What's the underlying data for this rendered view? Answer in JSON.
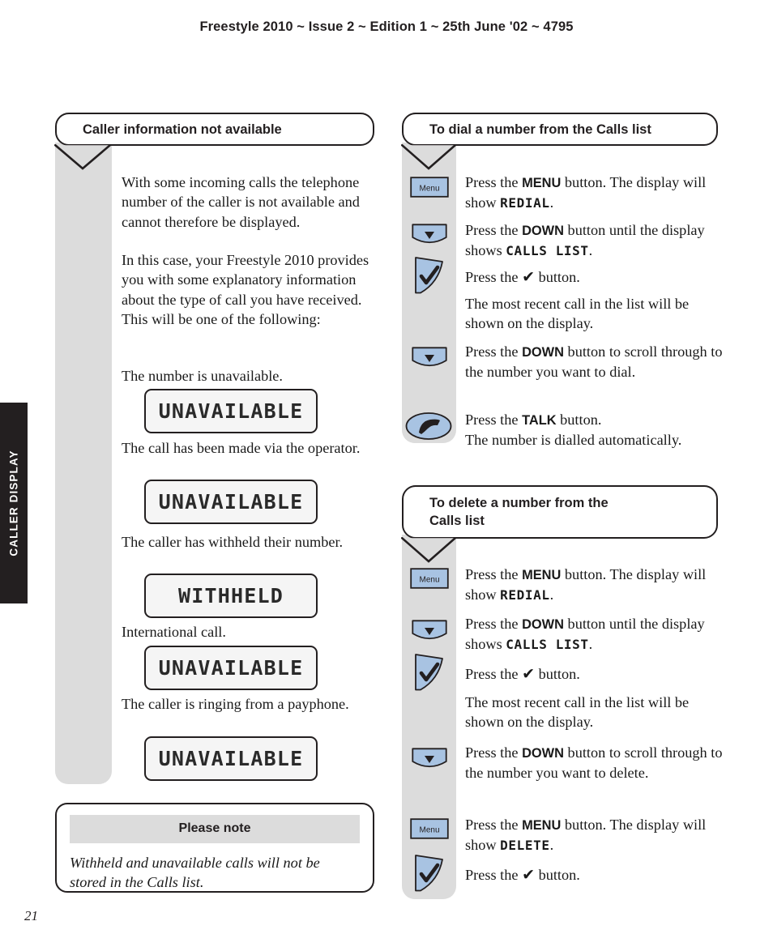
{
  "page": {
    "header": "Freestyle 2010 ~ Issue 2 ~ Edition 1 ~ 25th June '02 ~ 4795",
    "number": "21",
    "side_tab": "CALLER DISPLAY",
    "colors": {
      "ink": "#231f20",
      "grey_panel": "#dcdcdc",
      "button_blue": "#a8c3e2",
      "lcd_background": "#f5f5f5"
    }
  },
  "left_panel": {
    "heading": "Caller information not available",
    "paragraphs": [
      "With some incoming calls the telephone number of the caller is not available and cannot therefore be displayed.",
      "In this case, your Freestyle 2010 provides you with some explanatory information about the type of call you have received. This will be one of the following:"
    ],
    "cases": [
      {
        "caption": "The number is unavailable.",
        "display": "UNAVAILABLE"
      },
      {
        "caption": "The call has been made via the operator.",
        "display": "UNAVAILABLE"
      },
      {
        "caption": "The caller has withheld their number.",
        "display": "WITHHELD"
      },
      {
        "caption": "International call.",
        "display": "UNAVAILABLE"
      },
      {
        "caption": "The caller is ringing from a payphone.",
        "display": "UNAVAILABLE"
      }
    ],
    "note": {
      "title": "Please note",
      "body": "Withheld and unavailable calls will not be stored in the Calls list."
    }
  },
  "right_panel_dial": {
    "heading": "To dial a number from the Calls list",
    "steps": [
      {
        "icon": "menu-button-icon",
        "icon_label": "Menu",
        "text_pre": "Press the ",
        "button": "MENU",
        "text_mid": " button.  The display will show ",
        "lcd": "REDIAL",
        "text_post": "."
      },
      {
        "icon": "down-button-icon",
        "icon_label": "",
        "text_pre": "Press the ",
        "button": "DOWN",
        "text_mid": " button until the display shows ",
        "lcd": "CALLS LIST",
        "text_post": "."
      },
      {
        "icon": "tick-button-icon",
        "icon_label": "",
        "text_pre": "Press the ",
        "button": "✔",
        "text_mid": " button.",
        "lcd": "",
        "text_post": ""
      },
      {
        "icon": "",
        "icon_label": "",
        "text_pre": "The most recent call in the list will be shown on the display.",
        "button": "",
        "text_mid": "",
        "lcd": "",
        "text_post": ""
      },
      {
        "icon": "down-button-icon",
        "icon_label": "",
        "text_pre": "Press the ",
        "button": "DOWN",
        "text_mid": " button to scroll through to the number you want to dial.",
        "lcd": "",
        "text_post": ""
      },
      {
        "icon": "talk-button-icon",
        "icon_label": "",
        "text_pre": "Press the ",
        "button": "TALK",
        "text_mid": " button.",
        "lcd": "",
        "text_post": "",
        "extra_line": "The number is dialled automatically."
      }
    ]
  },
  "right_panel_delete": {
    "heading_line1": "To delete a number from the",
    "heading_line2": "Calls list",
    "steps": [
      {
        "icon": "menu-button-icon",
        "icon_label": "Menu",
        "text_pre": "Press the ",
        "button": "MENU",
        "text_mid": " button.  The display will show ",
        "lcd": "REDIAL",
        "text_post": "."
      },
      {
        "icon": "down-button-icon",
        "icon_label": "",
        "text_pre": "Press the ",
        "button": "DOWN",
        "text_mid": " button until the display shows ",
        "lcd": "CALLS LIST",
        "text_post": "."
      },
      {
        "icon": "tick-button-icon",
        "icon_label": "",
        "text_pre": "Press the ",
        "button": "✔",
        "text_mid": " button.",
        "lcd": "",
        "text_post": ""
      },
      {
        "icon": "",
        "icon_label": "",
        "text_pre": "The most recent call in the list will be shown on the display.",
        "button": "",
        "text_mid": "",
        "lcd": "",
        "text_post": ""
      },
      {
        "icon": "down-button-icon",
        "icon_label": "",
        "text_pre": "Press the ",
        "button": "DOWN",
        "text_mid": " button to scroll through to the number you want to delete.",
        "lcd": "",
        "text_post": ""
      },
      {
        "icon": "menu-button-icon",
        "icon_label": "Menu",
        "text_pre": "Press the ",
        "button": "MENU",
        "text_mid": " button.  The display will show ",
        "lcd": "DELETE",
        "text_post": "."
      },
      {
        "icon": "tick-button-icon",
        "icon_label": "",
        "text_pre": "Press the ",
        "button": "✔",
        "text_mid": " button.",
        "lcd": "",
        "text_post": ""
      }
    ]
  }
}
